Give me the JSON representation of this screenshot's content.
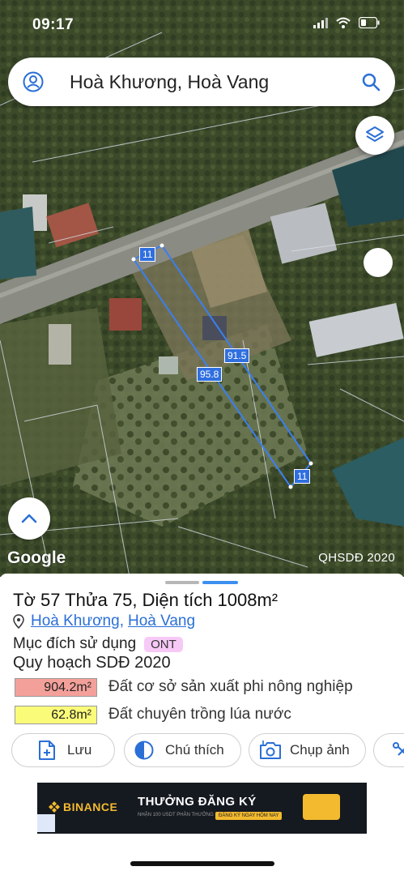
{
  "status": {
    "time": "09:17"
  },
  "search": {
    "query": "Hoà Khương, Hoà Vang"
  },
  "map": {
    "measures": {
      "top": "11",
      "right_side": "91.5",
      "left_side": "95.8",
      "bottom": "11"
    },
    "google_label": "Google",
    "plan_label": "QHSDĐ 2020"
  },
  "parcel": {
    "title": "Tờ 57 Thửa 75, Diện tích 1008m²",
    "address_commune": "Hoà Khương",
    "address_district": "Hoà Vang",
    "address_separator": ",",
    "usage_label": "Mục đích sử dụng",
    "usage_badge": "ONT",
    "plan_title": "Quy hoạch SDĐ 2020",
    "land": [
      {
        "area": "904.2m²",
        "desc": "Đất cơ sở sản xuất phi nông nghiệp",
        "color": "#f4a09a"
      },
      {
        "area": "62.8m²",
        "desc": "Đất chuyên trồng lúa nước",
        "color": "#fbfb7a"
      }
    ]
  },
  "actions": {
    "save": "Lưu",
    "note": "Chú thích",
    "capture": "Chụp ảnh"
  },
  "ad": {
    "brand": "BINANCE",
    "headline": "THƯỞNG ĐĂNG KÝ",
    "sub": "NHẬN 100 USDT PHẦN THƯỞNG",
    "cta": "ĐĂNG KÝ NGAY HÔM NAY"
  },
  "colors": {
    "accent": "#2a6fd6",
    "parcel_line": "#3b7ff0"
  },
  "icons": [
    "person-icon",
    "search-icon",
    "layers-icon",
    "chevron-up-icon",
    "location-pin-icon",
    "add-file-icon",
    "half-circle-icon",
    "camera-icon",
    "share-icon",
    "signal-icon",
    "wifi-icon",
    "battery-icon"
  ]
}
